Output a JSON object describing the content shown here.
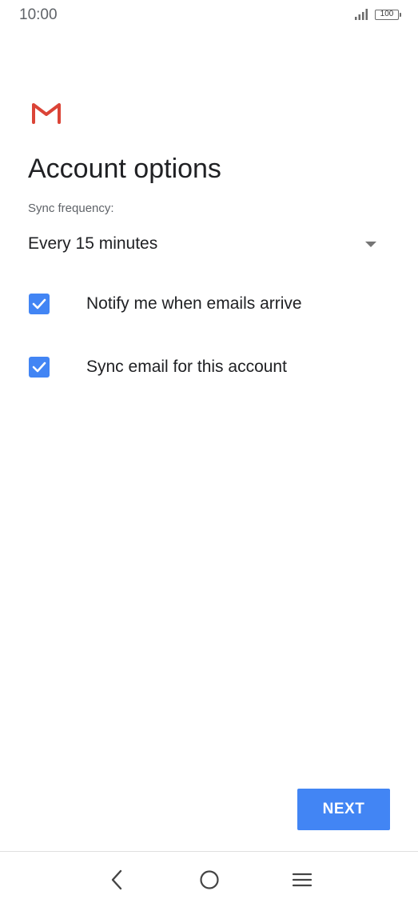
{
  "status_bar": {
    "time": "10:00",
    "battery_level": "100",
    "icons": [
      "signal-icon",
      "battery-icon"
    ]
  },
  "header": {
    "logo_icon": "gmail-logo-icon",
    "title": "Account options"
  },
  "sync": {
    "label": "Sync frequency:",
    "selected_value": "Every 15 minutes",
    "dropdown_icon": "dropdown-arrow-icon"
  },
  "options": [
    {
      "label": "Notify me when emails arrive",
      "checked": true
    },
    {
      "label": "Sync email for this account",
      "checked": true
    }
  ],
  "actions": {
    "next_label": "NEXT"
  },
  "navigation": {
    "icons": [
      "back-icon",
      "home-icon",
      "menu-icon"
    ]
  },
  "colors": {
    "accent": "#4285f4",
    "text_primary": "#202124",
    "text_secondary": "#5f6368",
    "gmail_red": "#db4437",
    "nav_icon": "#444444"
  }
}
